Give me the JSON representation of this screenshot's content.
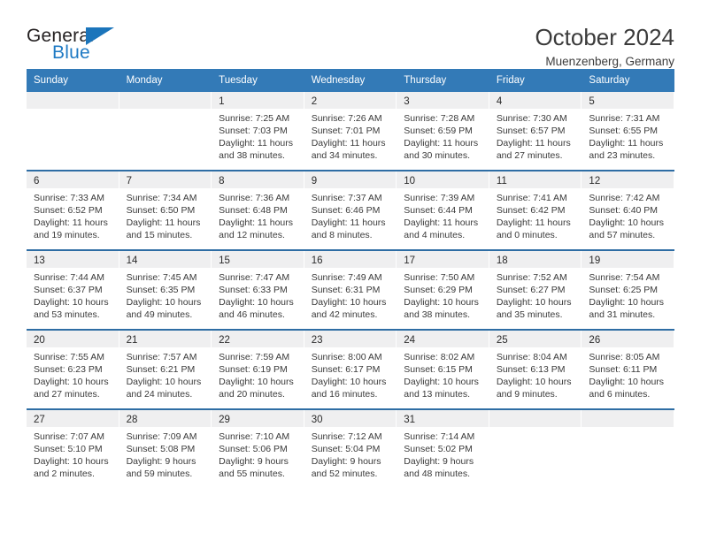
{
  "brand": {
    "name_part1": "General",
    "name_part2": "Blue"
  },
  "header": {
    "title": "October 2024",
    "subtitle": "Muenzenberg, Germany"
  },
  "colors": {
    "header_bar": "#337ab7",
    "week_divider": "#2e6da4",
    "brand_blue": "#1f7ac4",
    "day_band": "#efeff0"
  },
  "weekdays": [
    "Sunday",
    "Monday",
    "Tuesday",
    "Wednesday",
    "Thursday",
    "Friday",
    "Saturday"
  ],
  "weeks": [
    [
      {
        "day": "",
        "empty": true
      },
      {
        "day": "",
        "empty": true
      },
      {
        "day": "1",
        "sunrise": "Sunrise: 7:25 AM",
        "sunset": "Sunset: 7:03 PM",
        "daylight1": "Daylight: 11 hours",
        "daylight2": "and 38 minutes."
      },
      {
        "day": "2",
        "sunrise": "Sunrise: 7:26 AM",
        "sunset": "Sunset: 7:01 PM",
        "daylight1": "Daylight: 11 hours",
        "daylight2": "and 34 minutes."
      },
      {
        "day": "3",
        "sunrise": "Sunrise: 7:28 AM",
        "sunset": "Sunset: 6:59 PM",
        "daylight1": "Daylight: 11 hours",
        "daylight2": "and 30 minutes."
      },
      {
        "day": "4",
        "sunrise": "Sunrise: 7:30 AM",
        "sunset": "Sunset: 6:57 PM",
        "daylight1": "Daylight: 11 hours",
        "daylight2": "and 27 minutes."
      },
      {
        "day": "5",
        "sunrise": "Sunrise: 7:31 AM",
        "sunset": "Sunset: 6:55 PM",
        "daylight1": "Daylight: 11 hours",
        "daylight2": "and 23 minutes."
      }
    ],
    [
      {
        "day": "6",
        "sunrise": "Sunrise: 7:33 AM",
        "sunset": "Sunset: 6:52 PM",
        "daylight1": "Daylight: 11 hours",
        "daylight2": "and 19 minutes."
      },
      {
        "day": "7",
        "sunrise": "Sunrise: 7:34 AM",
        "sunset": "Sunset: 6:50 PM",
        "daylight1": "Daylight: 11 hours",
        "daylight2": "and 15 minutes."
      },
      {
        "day": "8",
        "sunrise": "Sunrise: 7:36 AM",
        "sunset": "Sunset: 6:48 PM",
        "daylight1": "Daylight: 11 hours",
        "daylight2": "and 12 minutes."
      },
      {
        "day": "9",
        "sunrise": "Sunrise: 7:37 AM",
        "sunset": "Sunset: 6:46 PM",
        "daylight1": "Daylight: 11 hours",
        "daylight2": "and 8 minutes."
      },
      {
        "day": "10",
        "sunrise": "Sunrise: 7:39 AM",
        "sunset": "Sunset: 6:44 PM",
        "daylight1": "Daylight: 11 hours",
        "daylight2": "and 4 minutes."
      },
      {
        "day": "11",
        "sunrise": "Sunrise: 7:41 AM",
        "sunset": "Sunset: 6:42 PM",
        "daylight1": "Daylight: 11 hours",
        "daylight2": "and 0 minutes."
      },
      {
        "day": "12",
        "sunrise": "Sunrise: 7:42 AM",
        "sunset": "Sunset: 6:40 PM",
        "daylight1": "Daylight: 10 hours",
        "daylight2": "and 57 minutes."
      }
    ],
    [
      {
        "day": "13",
        "sunrise": "Sunrise: 7:44 AM",
        "sunset": "Sunset: 6:37 PM",
        "daylight1": "Daylight: 10 hours",
        "daylight2": "and 53 minutes."
      },
      {
        "day": "14",
        "sunrise": "Sunrise: 7:45 AM",
        "sunset": "Sunset: 6:35 PM",
        "daylight1": "Daylight: 10 hours",
        "daylight2": "and 49 minutes."
      },
      {
        "day": "15",
        "sunrise": "Sunrise: 7:47 AM",
        "sunset": "Sunset: 6:33 PM",
        "daylight1": "Daylight: 10 hours",
        "daylight2": "and 46 minutes."
      },
      {
        "day": "16",
        "sunrise": "Sunrise: 7:49 AM",
        "sunset": "Sunset: 6:31 PM",
        "daylight1": "Daylight: 10 hours",
        "daylight2": "and 42 minutes."
      },
      {
        "day": "17",
        "sunrise": "Sunrise: 7:50 AM",
        "sunset": "Sunset: 6:29 PM",
        "daylight1": "Daylight: 10 hours",
        "daylight2": "and 38 minutes."
      },
      {
        "day": "18",
        "sunrise": "Sunrise: 7:52 AM",
        "sunset": "Sunset: 6:27 PM",
        "daylight1": "Daylight: 10 hours",
        "daylight2": "and 35 minutes."
      },
      {
        "day": "19",
        "sunrise": "Sunrise: 7:54 AM",
        "sunset": "Sunset: 6:25 PM",
        "daylight1": "Daylight: 10 hours",
        "daylight2": "and 31 minutes."
      }
    ],
    [
      {
        "day": "20",
        "sunrise": "Sunrise: 7:55 AM",
        "sunset": "Sunset: 6:23 PM",
        "daylight1": "Daylight: 10 hours",
        "daylight2": "and 27 minutes."
      },
      {
        "day": "21",
        "sunrise": "Sunrise: 7:57 AM",
        "sunset": "Sunset: 6:21 PM",
        "daylight1": "Daylight: 10 hours",
        "daylight2": "and 24 minutes."
      },
      {
        "day": "22",
        "sunrise": "Sunrise: 7:59 AM",
        "sunset": "Sunset: 6:19 PM",
        "daylight1": "Daylight: 10 hours",
        "daylight2": "and 20 minutes."
      },
      {
        "day": "23",
        "sunrise": "Sunrise: 8:00 AM",
        "sunset": "Sunset: 6:17 PM",
        "daylight1": "Daylight: 10 hours",
        "daylight2": "and 16 minutes."
      },
      {
        "day": "24",
        "sunrise": "Sunrise: 8:02 AM",
        "sunset": "Sunset: 6:15 PM",
        "daylight1": "Daylight: 10 hours",
        "daylight2": "and 13 minutes."
      },
      {
        "day": "25",
        "sunrise": "Sunrise: 8:04 AM",
        "sunset": "Sunset: 6:13 PM",
        "daylight1": "Daylight: 10 hours",
        "daylight2": "and 9 minutes."
      },
      {
        "day": "26",
        "sunrise": "Sunrise: 8:05 AM",
        "sunset": "Sunset: 6:11 PM",
        "daylight1": "Daylight: 10 hours",
        "daylight2": "and 6 minutes."
      }
    ],
    [
      {
        "day": "27",
        "sunrise": "Sunrise: 7:07 AM",
        "sunset": "Sunset: 5:10 PM",
        "daylight1": "Daylight: 10 hours",
        "daylight2": "and 2 minutes."
      },
      {
        "day": "28",
        "sunrise": "Sunrise: 7:09 AM",
        "sunset": "Sunset: 5:08 PM",
        "daylight1": "Daylight: 9 hours",
        "daylight2": "and 59 minutes."
      },
      {
        "day": "29",
        "sunrise": "Sunrise: 7:10 AM",
        "sunset": "Sunset: 5:06 PM",
        "daylight1": "Daylight: 9 hours",
        "daylight2": "and 55 minutes."
      },
      {
        "day": "30",
        "sunrise": "Sunrise: 7:12 AM",
        "sunset": "Sunset: 5:04 PM",
        "daylight1": "Daylight: 9 hours",
        "daylight2": "and 52 minutes."
      },
      {
        "day": "31",
        "sunrise": "Sunrise: 7:14 AM",
        "sunset": "Sunset: 5:02 PM",
        "daylight1": "Daylight: 9 hours",
        "daylight2": "and 48 minutes."
      },
      {
        "day": "",
        "empty": true
      },
      {
        "day": "",
        "empty": true
      }
    ]
  ]
}
